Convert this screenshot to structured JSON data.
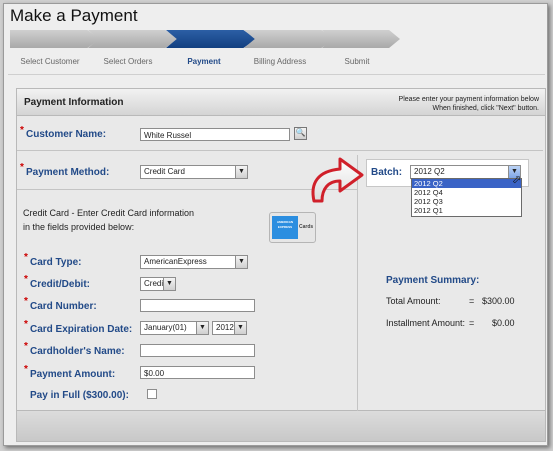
{
  "page": {
    "title": "Make a Payment"
  },
  "wizard": {
    "steps": [
      {
        "label": "Select Customer",
        "active": false
      },
      {
        "label": "Select Orders",
        "active": false
      },
      {
        "label": "Payment",
        "active": true
      },
      {
        "label": "Billing Address",
        "active": false
      },
      {
        "label": "Submit",
        "active": false
      }
    ]
  },
  "panel": {
    "title": "Payment Information",
    "hint_line1": "Please enter your payment information below",
    "hint_line2": "When finished, click \"Next\" button."
  },
  "form": {
    "customer_name_label": "Customer Name:",
    "customer_name_value": "White Russel",
    "payment_method_label": "Payment Method:",
    "payment_method_value": "Credit Card",
    "cc_desc_line1": "Credit Card - Enter Credit Card information",
    "cc_desc_line2": "in the fields provided below:",
    "amex_logo_text": "AMERICAN EXPRESS",
    "amex_cards_text": "Cards",
    "card_type_label": "Card Type:",
    "card_type_value": "AmericanExpress",
    "credit_debit_label": "Credit/Debit:",
    "credit_debit_value": "Credit",
    "card_number_label": "Card Number:",
    "card_number_value": "",
    "expiration_label": "Card Expiration Date:",
    "expiration_month": "January(01)",
    "expiration_year": "2012",
    "cardholder_label": "Cardholder's Name:",
    "cardholder_value": "",
    "payment_amount_label": "Payment Amount:",
    "payment_amount_value": "$0.00",
    "pay_in_full_label": "Pay in Full ($300.00):",
    "pay_in_full_checked": false
  },
  "batch": {
    "label": "Batch:",
    "selected": "2012 Q2",
    "options": [
      "2012 Q2",
      "2012 Q4",
      "2012 Q3",
      "2012 Q1"
    ]
  },
  "summary": {
    "title": "Payment Summary:",
    "total_label": "Total Amount:",
    "total_eq": "=",
    "total_value": "$300.00",
    "installment_label": "Installment Amount:",
    "installment_eq": "=",
    "installment_value": "$0.00"
  },
  "colors": {
    "accent": "#224a88",
    "required": "#cc0000",
    "active_step": "#1a4a8e",
    "selected_option": "#3a63c6"
  }
}
